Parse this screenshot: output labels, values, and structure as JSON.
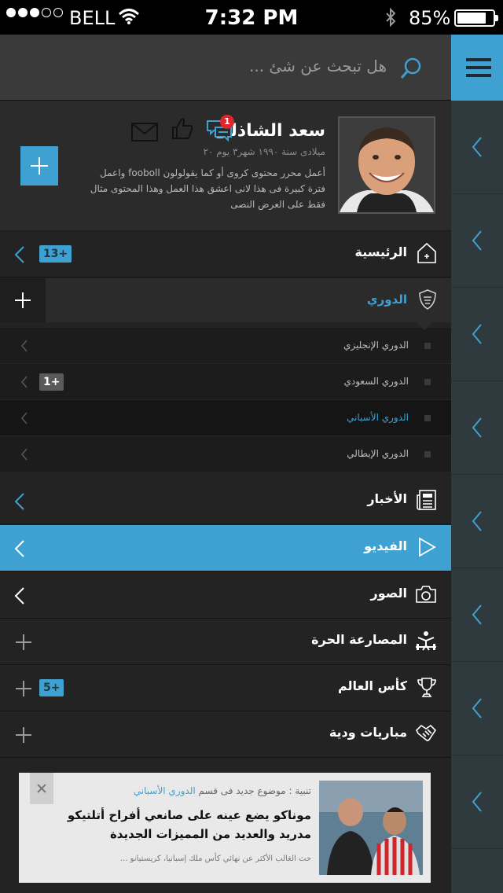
{
  "status_bar": {
    "carrier": "BELL",
    "time": "7:32 PM",
    "battery": "85%",
    "battery_level": 0.85,
    "signal_bars": 3
  },
  "search": {
    "placeholder": "هل تبحث عن شئ ..."
  },
  "profile": {
    "name": "سعد الشاذلى",
    "date": "ميلادى سنة ١٩٩٠ شهر٣ يوم ٢٠",
    "bio": "أعمل محرر محتوى كروى أو كما يقولولون fooboll واعمل فترة كبيرة فى هذا لانى اعشق هذا العمل وهذا المحتوى مثال فقط على العرض النصى",
    "message_badge": "1"
  },
  "menu": {
    "home": {
      "label": "الرئيسية",
      "count": "13+"
    },
    "league": {
      "label": "الدوري",
      "subitems": [
        {
          "label": "الدوري الإنجليزي",
          "count": ""
        },
        {
          "label": "الدوري السعودي",
          "count": "1+"
        },
        {
          "label": "الدوري الأسباني",
          "count": ""
        },
        {
          "label": "الدوري الإيطالي",
          "count": ""
        }
      ]
    },
    "news": {
      "label": "الأخبار"
    },
    "video": {
      "label": "الفيديو"
    },
    "photos": {
      "label": "الصور"
    },
    "wrestling": {
      "label": "المصارعة الحرة"
    },
    "worldcup": {
      "label": "كأس العالم",
      "count": "5+"
    },
    "friendlies": {
      "label": "مباريات ودية"
    }
  },
  "notification": {
    "prefix": "تنبية :",
    "text": "موضوع جديد فى قسم",
    "section": "الدوري الأسباني",
    "title": "موناكو يضع عينه على صانعي أفراح أتلتيكو مدريد والعديد من المميزات الجديدة",
    "description": "حث الغالب الأكثر عن نهائي كأس ملك إسبانيا، كريستيانو ..."
  },
  "colors": {
    "accent": "#3ea1d1",
    "drawer_bg": "#232323",
    "rail_bg": "#2f3a3f",
    "badge_red": "#e0262a"
  }
}
